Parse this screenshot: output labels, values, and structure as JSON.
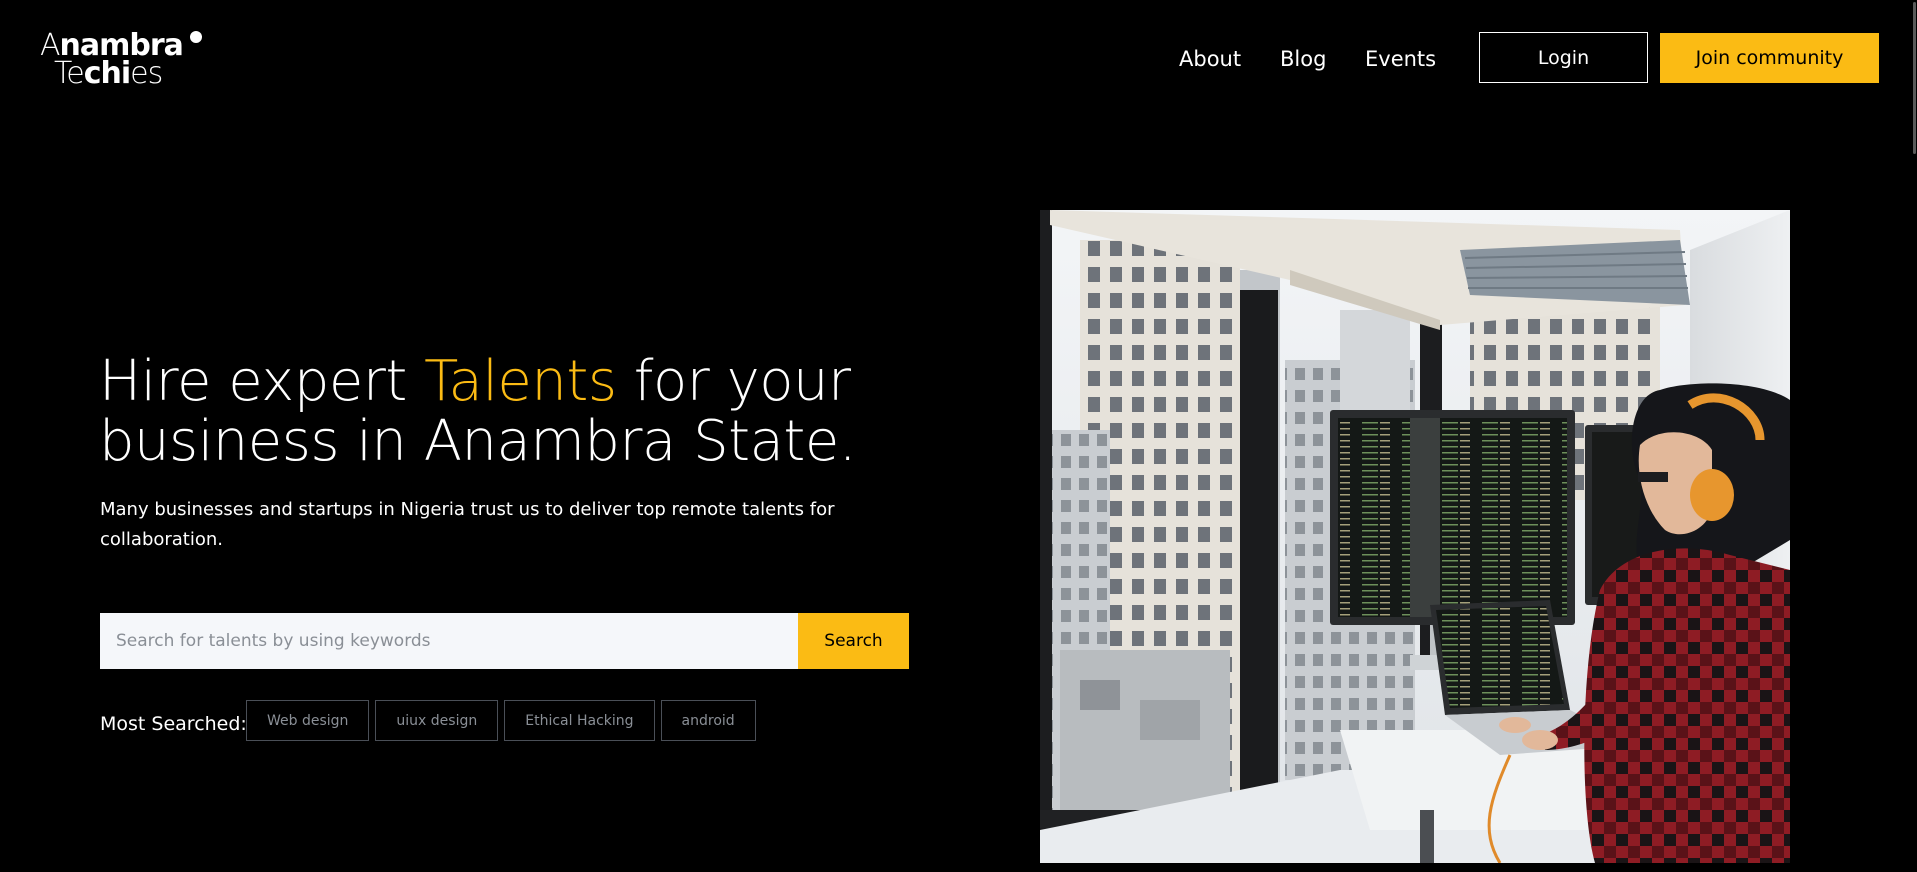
{
  "header": {
    "logo": {
      "line1_thin": "A",
      "line1_bold": "na",
      "line1_bold2": "mbra",
      "line2_thin": "Te",
      "line2_bold": "chi",
      "line2_thin2": "es"
    },
    "nav": [
      {
        "label": "About"
      },
      {
        "label": "Blog"
      },
      {
        "label": "Events"
      }
    ],
    "login_label": "Login",
    "join_label": "Join community"
  },
  "hero": {
    "title_part1": "Hire expert ",
    "title_accent": "Talents",
    "title_part2": " for your business in Anambra State.",
    "subtitle": "Many businesses and startups in Nigeria trust us to deliver top remote talents for collaboration.",
    "search": {
      "placeholder": "Search for talents by using keywords",
      "value": "",
      "button_label": "Search"
    },
    "most_searched_label": "Most Searched:",
    "tags": [
      "Web design",
      "uiux design",
      "Ethical Hacking",
      "android"
    ]
  },
  "colors": {
    "accent": "#fbbb14",
    "background": "#000000",
    "text": "#ffffff"
  }
}
